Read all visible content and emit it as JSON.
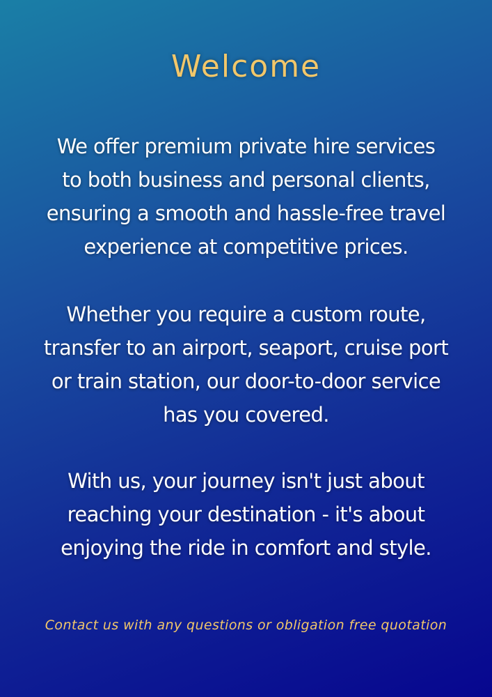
{
  "title": "Welcome",
  "paragraphs": [
    {
      "lines": [
        "We offer premium private hire services",
        "to both business and personal clients,",
        "ensuring a smooth and hassle-free travel",
        "experience at competitive prices."
      ]
    },
    {
      "lines": [
        "Whether you require a custom route,",
        "transfer to an airport, seaport, cruise port",
        "or train station, our door-to-door service",
        "has you covered."
      ]
    },
    {
      "lines": [
        "With us, your journey isn't just about",
        "reaching your destination - it's about",
        "enjoying the ride in comfort and style."
      ]
    }
  ],
  "contact": "Contact us with any questions or obligation free quotation",
  "colors": {
    "accent": "#f2c76a",
    "text": "#ffffff",
    "background_top": "#1a7fa6",
    "background_bottom": "#07068f"
  }
}
